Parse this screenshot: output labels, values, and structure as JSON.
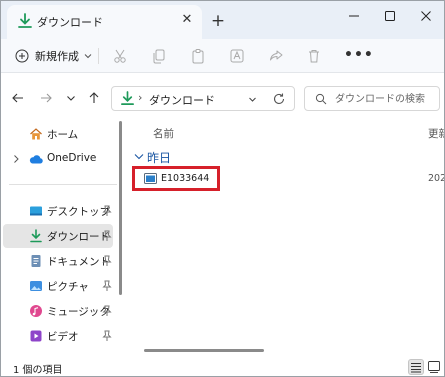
{
  "window": {
    "tab_title": "ダウンロード",
    "tab_close": "✕",
    "new_tab": "+"
  },
  "toolbar": {
    "new_label": "新規作成",
    "more_label": "•••"
  },
  "address": {
    "separator": "›",
    "path": "ダウンロード",
    "search_placeholder": "ダウンロードの検索"
  },
  "sidebar": {
    "items": [
      {
        "label": "ホーム",
        "icon": "home-icon"
      },
      {
        "label": "OneDrive",
        "icon": "cloud-icon"
      },
      {
        "label": "デスクトップ",
        "icon": "desktop-icon",
        "pinned": true
      },
      {
        "label": "ダウンロード",
        "icon": "download-icon",
        "pinned": true,
        "selected": true
      },
      {
        "label": "ドキュメント",
        "icon": "document-icon",
        "pinned": true
      },
      {
        "label": "ピクチャ",
        "icon": "pictures-icon",
        "pinned": true
      },
      {
        "label": "ミュージック",
        "icon": "music-icon",
        "pinned": true
      },
      {
        "label": "ビデオ",
        "icon": "video-icon",
        "pinned": true
      }
    ]
  },
  "content": {
    "column_name": "名前",
    "column_date": "更新",
    "group_label": "昨日",
    "files": [
      {
        "name": "E1033644",
        "date": "202",
        "icon": "application-icon"
      }
    ]
  },
  "status": {
    "text": "1 個の項目"
  },
  "colors": {
    "accent": "#1a56a3",
    "highlight_border": "#d6202a",
    "download_green": "#1e9a5a"
  }
}
